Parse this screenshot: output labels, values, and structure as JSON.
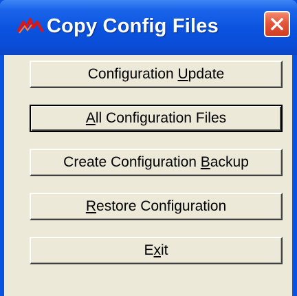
{
  "window": {
    "title": "Copy Config Files",
    "app_icon": "red-wave-logo-icon",
    "close_icon": "close-icon",
    "colors": {
      "titlebar": "#0a52de",
      "client": "#ece9d8",
      "close": "#e4573b"
    }
  },
  "buttons": [
    {
      "pre": "Configuration ",
      "key": "U",
      "post": "pdate"
    },
    {
      "pre": "",
      "key": "A",
      "post": "ll Configuration Files"
    },
    {
      "pre": "Create Configuration ",
      "key": "B",
      "post": "ackup"
    },
    {
      "pre": "",
      "key": "R",
      "post": "estore Configuration"
    },
    {
      "pre": "E",
      "key": "x",
      "post": "it"
    }
  ]
}
